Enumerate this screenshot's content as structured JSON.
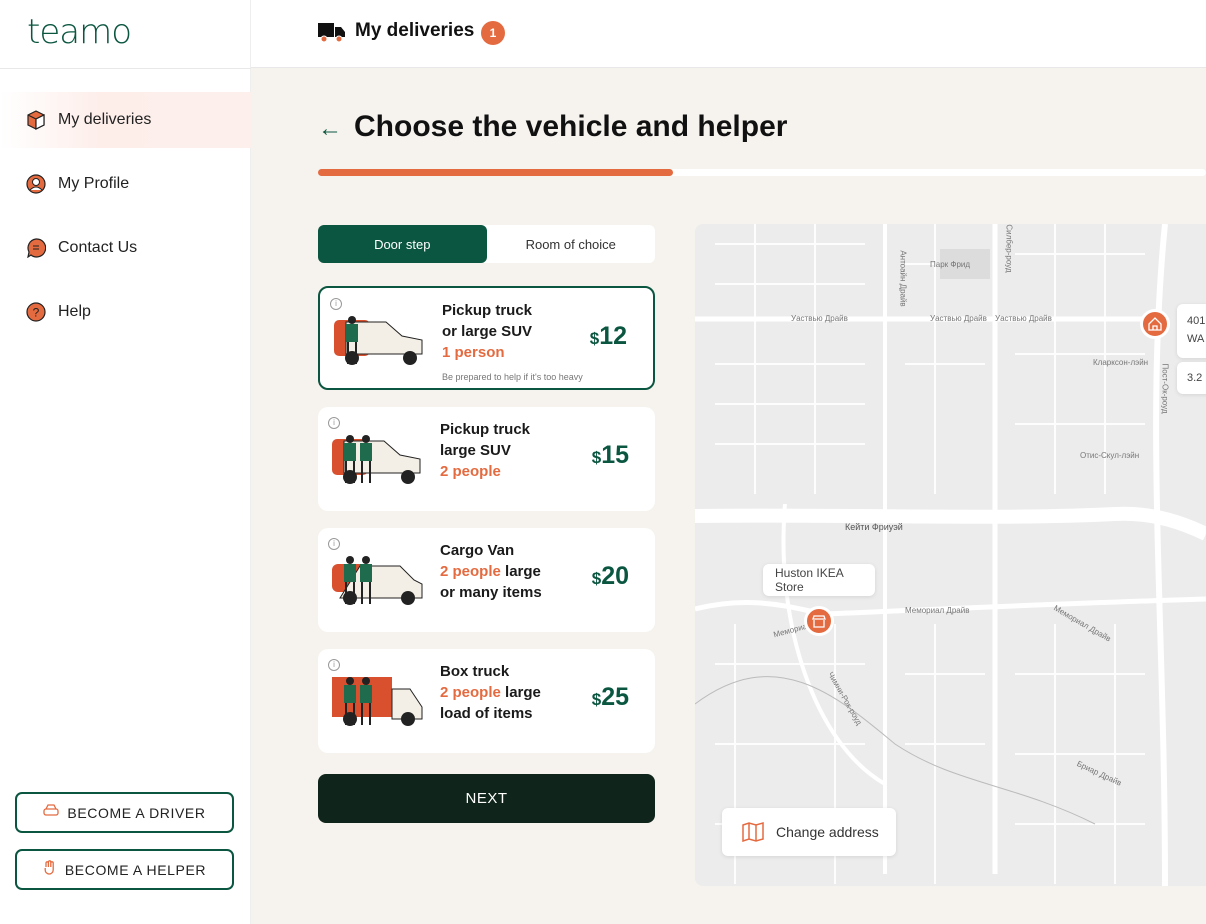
{
  "brand": {
    "logo": "teamo",
    "accent": "#e46a40",
    "primary": "#0b5640"
  },
  "sidebar": {
    "items": [
      {
        "label": "My deliveries",
        "icon": "box-icon",
        "active": true
      },
      {
        "label": "My Profile",
        "icon": "user-icon"
      },
      {
        "label": "Contact Us",
        "icon": "chat-icon"
      },
      {
        "label": "Help",
        "icon": "help-icon"
      }
    ],
    "become_driver": "BECOME A DRIVER",
    "become_helper": "BECOME A HELPER"
  },
  "header": {
    "title": "My deliveries",
    "badge": "1"
  },
  "page": {
    "title": "Choose the vehicle and helper",
    "progress_percent": 40
  },
  "toggle": {
    "options": [
      "Door step",
      "Room of choice"
    ],
    "selected": "Door step"
  },
  "vehicles": [
    {
      "line1": "Pickup truck",
      "line2": "or large SUV",
      "people": "1 person",
      "line3": "",
      "note": "Be prepared to help if it's too heavy",
      "price": "12",
      "selected": true
    },
    {
      "line1": "Pickup truck",
      "line2": "large SUV",
      "people": "2 people",
      "line3": "",
      "note": "",
      "price": "15"
    },
    {
      "line1": "Cargo Van",
      "line2": "",
      "people": "2 people",
      "suffix": " large",
      "line3": "or many items",
      "note": "",
      "price": "20"
    },
    {
      "line1": "Box truck",
      "line2": "",
      "people": "2 people",
      "suffix": " large",
      "line3": "load of items",
      "note": "",
      "price": "25"
    }
  ],
  "currency": "$",
  "next_label": "NEXT",
  "map": {
    "store_label": "Huston IKEA Store",
    "change_address": "Change address",
    "address_line1": "401",
    "address_line2": "WA",
    "distance": "3.2",
    "streets": [
      "Уаствью Драйв",
      "Уаствью Драйв",
      "Уаствью Драйв",
      "Кейти Фриуэй",
      "Мемориал Драйв",
      "Мемориал Драйв",
      "Мемориа",
      "Силбер-роуд",
      "Антоайн Драйв",
      "Пост-Ок-роуд",
      "Парк Фрид",
      "Чимни-Рок-роуд",
      "Бриар Драйв",
      "Кларксон-лэйн",
      "Отис-Скул-лэйн"
    ]
  }
}
